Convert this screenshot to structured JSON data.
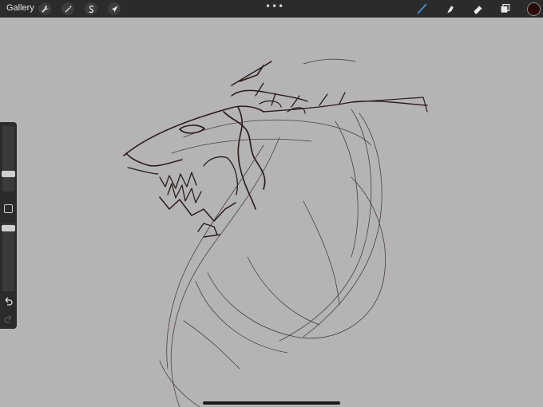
{
  "toolbar": {
    "gallery_label": "Gallery",
    "left_tools": [
      "wrench-icon",
      "magic-wand-icon",
      "selection-icon",
      "transform-arrow-icon"
    ],
    "more_label": "•••",
    "right_tools": [
      "brush-icon",
      "smudge-icon",
      "eraser-icon",
      "layers-icon"
    ],
    "brush_active_color": "#4a90e2",
    "current_color": "#2a0a0a"
  },
  "sidebar": {
    "brush_size_level": 0.25,
    "opacity_level": 0.05
  },
  "canvas": {
    "background": "#b4b4b4",
    "ink_color": "#2a1a1a"
  }
}
